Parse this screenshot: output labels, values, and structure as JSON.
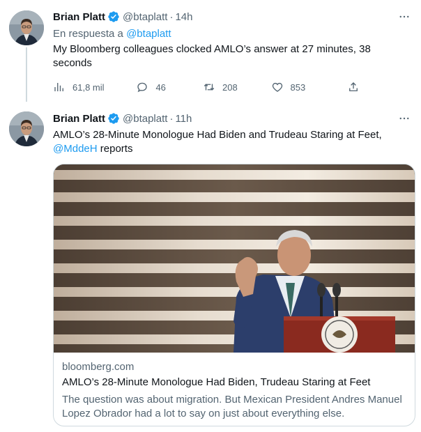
{
  "tweets": [
    {
      "author_name": "Brian Platt",
      "handle": "@btaplatt",
      "separator": "·",
      "time": "14h",
      "reply_prefix": "En respuesta a",
      "reply_handle": "@btaplatt",
      "text": "My Bloomberg colleagues clocked AMLO’s answer at 27 minutes, 38 seconds",
      "stats": {
        "views": "61,8 mil",
        "replies": "46",
        "retweets": "208",
        "likes": "853"
      }
    },
    {
      "author_name": "Brian Platt",
      "handle": "@btaplatt",
      "separator": "·",
      "time": "11h",
      "text_main": "AMLO’s 28-Minute Monologue Had Biden and Trudeau Staring at Feet,",
      "mention": "@MddeH",
      "text_suffix": " reports",
      "card": {
        "domain": "bloomberg.com",
        "title": "AMLO’s 28-Minute Monologue Had Biden, Trudeau Staring at Feet",
        "description": "The question was about migration. But Mexican President Andres Manuel Lopez Obrador had a lot to say on just about everything else."
      }
    }
  ],
  "more_icon": "more-dots-icon",
  "colors": {
    "link": "#1d9bf0",
    "secondary": "#536471",
    "verified": "#1d9bf0",
    "border": "#cfd9de"
  }
}
